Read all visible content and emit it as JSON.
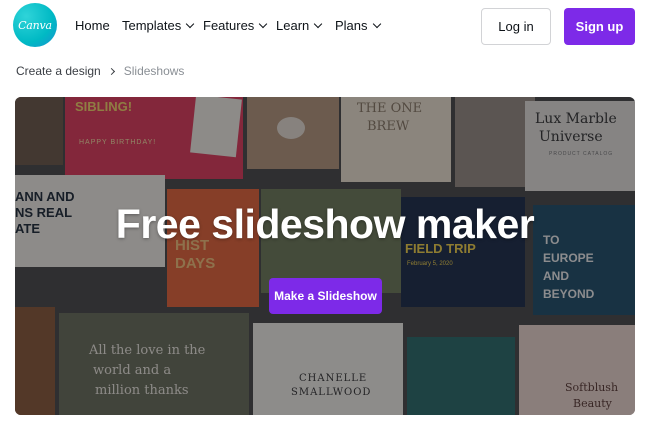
{
  "brand": {
    "logo_text": "Canva",
    "accent": "#7d2ae8",
    "logo_color": "#00c4cc"
  },
  "nav": {
    "items": [
      {
        "label": "Home",
        "has_dropdown": false
      },
      {
        "label": "Templates",
        "has_dropdown": true
      },
      {
        "label": "Features",
        "has_dropdown": true
      },
      {
        "label": "Learn",
        "has_dropdown": true
      },
      {
        "label": "Plans",
        "has_dropdown": true
      }
    ],
    "login_label": "Log in",
    "signup_label": "Sign up"
  },
  "breadcrumb": {
    "parent": "Create a design",
    "current": "Slideshows"
  },
  "hero": {
    "title": "Free slideshow maker",
    "cta_label": "Make a Slideshow",
    "background_templates": {
      "sibling": "SIBLING!",
      "happy_birthday": "HAPPY BIRTHDAY!",
      "the_one_brew_1": "THE ONE",
      "the_one_brew_2": "BREW",
      "lux_marble_1": "Lux Marble",
      "lux_marble_2": "Universe",
      "lux_marble_3": "PRODUCT CATALOG",
      "ann_real_1": "ANN AND",
      "ann_real_2": "NS REAL",
      "ann_real_3": "ATE",
      "hist_days_1": "HIST",
      "hist_days_2": "DAYS",
      "field_trip": "FIELD TRIP",
      "field_trip_date": "February 5, 2020",
      "europe_1": "TO",
      "europe_2": "EUROPE",
      "europe_3": "AND",
      "europe_4": "BEYOND",
      "love_1": "All the love in the",
      "love_2": "world and a",
      "love_3": "million thanks",
      "chanelle_1": "CHANELLE",
      "chanelle_2": "SMALLWOOD",
      "softblush_1": "Softblush",
      "softblush_2": "Beauty"
    }
  }
}
